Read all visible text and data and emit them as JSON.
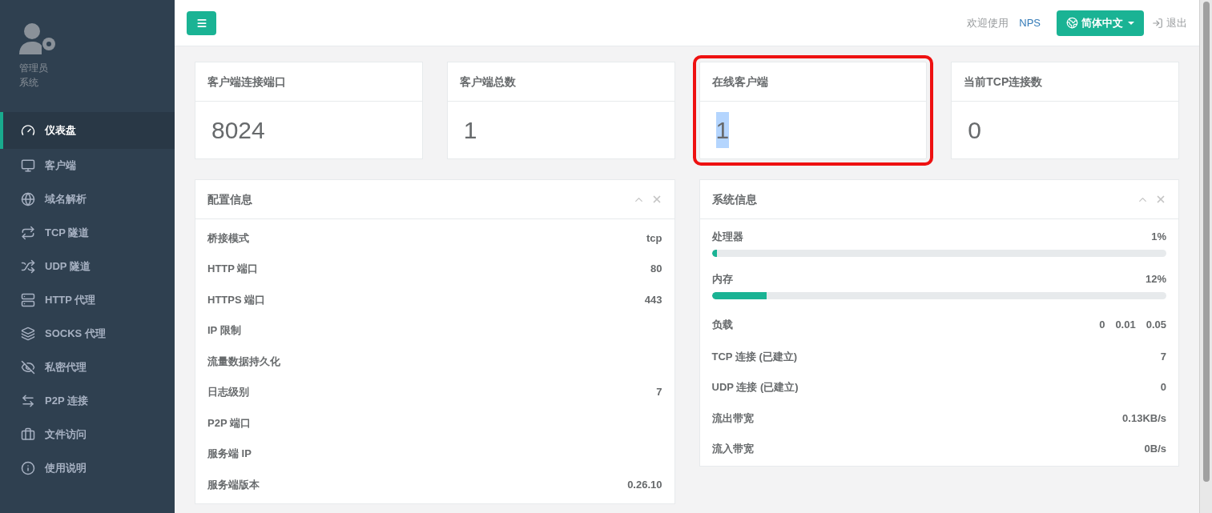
{
  "user": {
    "name": "管理员",
    "role": "系统"
  },
  "sidebar": {
    "items": [
      {
        "label": "仪表盘",
        "selected": true
      },
      {
        "label": "客户端",
        "selected": false
      },
      {
        "label": "域名解析",
        "selected": false
      },
      {
        "label": "TCP 隧道",
        "selected": false
      },
      {
        "label": "UDP 隧道",
        "selected": false
      },
      {
        "label": "HTTP 代理",
        "selected": false
      },
      {
        "label": "SOCKS 代理",
        "selected": false
      },
      {
        "label": "私密代理",
        "selected": false
      },
      {
        "label": "P2P 连接",
        "selected": false
      },
      {
        "label": "文件访问",
        "selected": false
      },
      {
        "label": "使用说明",
        "selected": false
      }
    ]
  },
  "topbar": {
    "welcome": "欢迎使用",
    "brand": "NPS",
    "language": "简体中文",
    "logout": "退出"
  },
  "stats": [
    {
      "title": "客户端连接端口",
      "value": "8024",
      "outlined": false
    },
    {
      "title": "客户端总数",
      "value": "1",
      "outlined": false
    },
    {
      "title": "在线客户端",
      "value": "1",
      "outlined": true
    },
    {
      "title": "当前TCP连接数",
      "value": "0",
      "outlined": false
    }
  ],
  "config_panel": {
    "title": "配置信息",
    "rows": [
      {
        "label": "桥接模式",
        "value": "tcp"
      },
      {
        "label": "HTTP 端口",
        "value": "80"
      },
      {
        "label": "HTTPS 端口",
        "value": "443"
      },
      {
        "label": "IP 限制",
        "value": ""
      },
      {
        "label": "流量数据持久化",
        "value": ""
      },
      {
        "label": "日志级别",
        "value": "7"
      },
      {
        "label": "P2P 端口",
        "value": ""
      },
      {
        "label": "服务端 IP",
        "value": ""
      },
      {
        "label": "服务端版本",
        "value": "0.26.10"
      }
    ]
  },
  "system_panel": {
    "title": "系统信息",
    "rows": [
      {
        "kind": "meter",
        "label": "处理器",
        "value": "1%",
        "level": 0.01
      },
      {
        "kind": "meter",
        "label": "内存",
        "value": "12%",
        "level": 0.12
      },
      {
        "kind": "multi",
        "label": "负载",
        "values": [
          "0",
          "0.01",
          "0.05"
        ]
      },
      {
        "kind": "text",
        "label": "TCP 连接 (已建立)",
        "value": "7"
      },
      {
        "kind": "text",
        "label": "UDP 连接 (已建立)",
        "value": "0"
      },
      {
        "kind": "text",
        "label": "流出带宽",
        "value": "0.13KB/s"
      },
      {
        "kind": "text",
        "label": "流入带宽",
        "value": "0B/s"
      }
    ]
  }
}
